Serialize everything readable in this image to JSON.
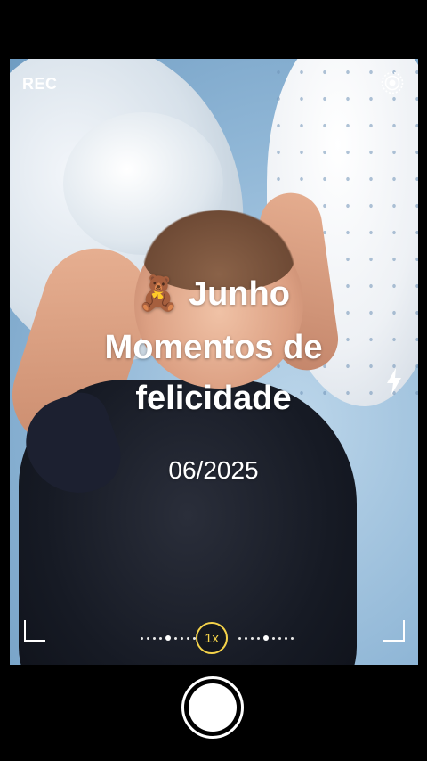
{
  "camera": {
    "rec_label": "REC",
    "zoom_label": "1x",
    "accent_color": "#f5d34a"
  },
  "overlay": {
    "emoji": "🧸",
    "title_word": "Junho",
    "line2": "Momentos de",
    "line3": "felicidade",
    "date": "06/2025"
  },
  "icons": {
    "top_right": "settings-rings-icon",
    "right_side": "flash-icon",
    "bottom": "shutter-button"
  }
}
